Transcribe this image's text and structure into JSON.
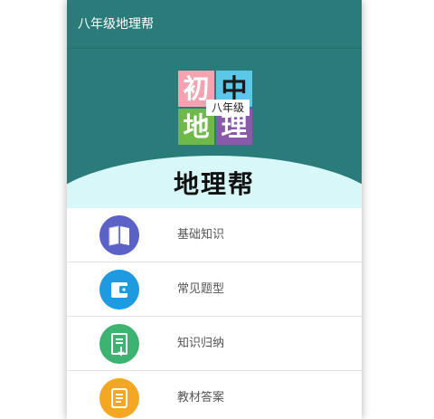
{
  "appbar": {
    "title": "八年级地理帮"
  },
  "logo": {
    "chars": [
      "初",
      "中",
      "地",
      "理"
    ],
    "badge": "八年级"
  },
  "header": {
    "app_name": "地理帮"
  },
  "menu": {
    "items": [
      {
        "label": "基础知识",
        "icon": "book-icon",
        "color": "#5a62c8"
      },
      {
        "label": "常见题型",
        "icon": "wallet-icon",
        "color": "#1e9be0"
      },
      {
        "label": "知识归纳",
        "icon": "document-icon",
        "color": "#3cb371"
      },
      {
        "label": "教材答案",
        "icon": "notepad-icon",
        "color": "#f5a623"
      }
    ]
  },
  "colors": {
    "appbar": "#2a7c7a",
    "header_arc": "#d8f7f8"
  }
}
